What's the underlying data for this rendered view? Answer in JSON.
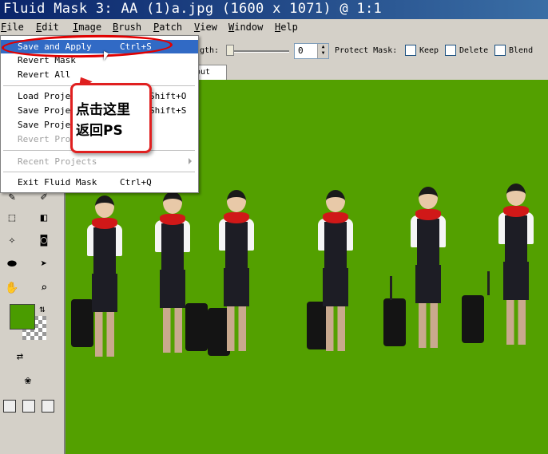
{
  "window": {
    "title": "Fluid Mask 3: AA (1)a.jpg (1600 x 1071) @ 1:1"
  },
  "menubar": {
    "file": {
      "u": "F",
      "rest": "ile"
    },
    "edit": {
      "u": "E",
      "rest": "dit"
    },
    "image": {
      "u": "I",
      "rest": "mage"
    },
    "brush": {
      "u": "B",
      "rest": "rush"
    },
    "patch": {
      "u": "P",
      "rest": "atch"
    },
    "view": {
      "u": "V",
      "rest": "iew"
    },
    "window": {
      "u": "W",
      "rest": "indow"
    },
    "help": {
      "u": "H",
      "rest": "elp"
    }
  },
  "toolbar": {
    "strength_label": "gth:",
    "strength_value": "0",
    "protect_mask_label": "Protect Mask:",
    "keep_label": "Keep",
    "delete_label": "Delete",
    "blend_label": "Blend"
  },
  "tab": {
    "label": "out"
  },
  "file_menu": {
    "items": [
      {
        "label": "Save and Apply",
        "shortcut": "Ctrl+S"
      },
      {
        "label": "Revert Mask",
        "shortcut": ""
      },
      {
        "label": "Revert All",
        "shortcut": ""
      },
      {
        "label": "Load Project",
        "shortcut": "Shift+O"
      },
      {
        "label": "Save Project",
        "shortcut": "Shift+S"
      },
      {
        "label": "Save Project As",
        "shortcut": ""
      },
      {
        "label": "Revert Project",
        "shortcut": ""
      },
      {
        "label": "Recent Projects",
        "shortcut": ""
      },
      {
        "label": "Exit Fluid Mask",
        "shortcut": "Ctrl+Q"
      }
    ]
  },
  "annotation": {
    "line1": "点击这里",
    "line2": "返回PS"
  },
  "colors": {
    "canvas_bg": "#53a000",
    "foreground": "#4a9c00",
    "annotation": "#e00000",
    "menu_highlight": "#316ac5"
  },
  "icons": [
    "cursor-arrow-icon",
    "lasso-icon",
    "brush-icon",
    "select-rect-icon",
    "fill-icon",
    "magic-icon",
    "camera-icon",
    "eraser-icon",
    "pointer-icon",
    "hand-icon",
    "zoom-icon",
    "swap-arrows-icon",
    "person-swap-icon",
    "palette-icon"
  ]
}
